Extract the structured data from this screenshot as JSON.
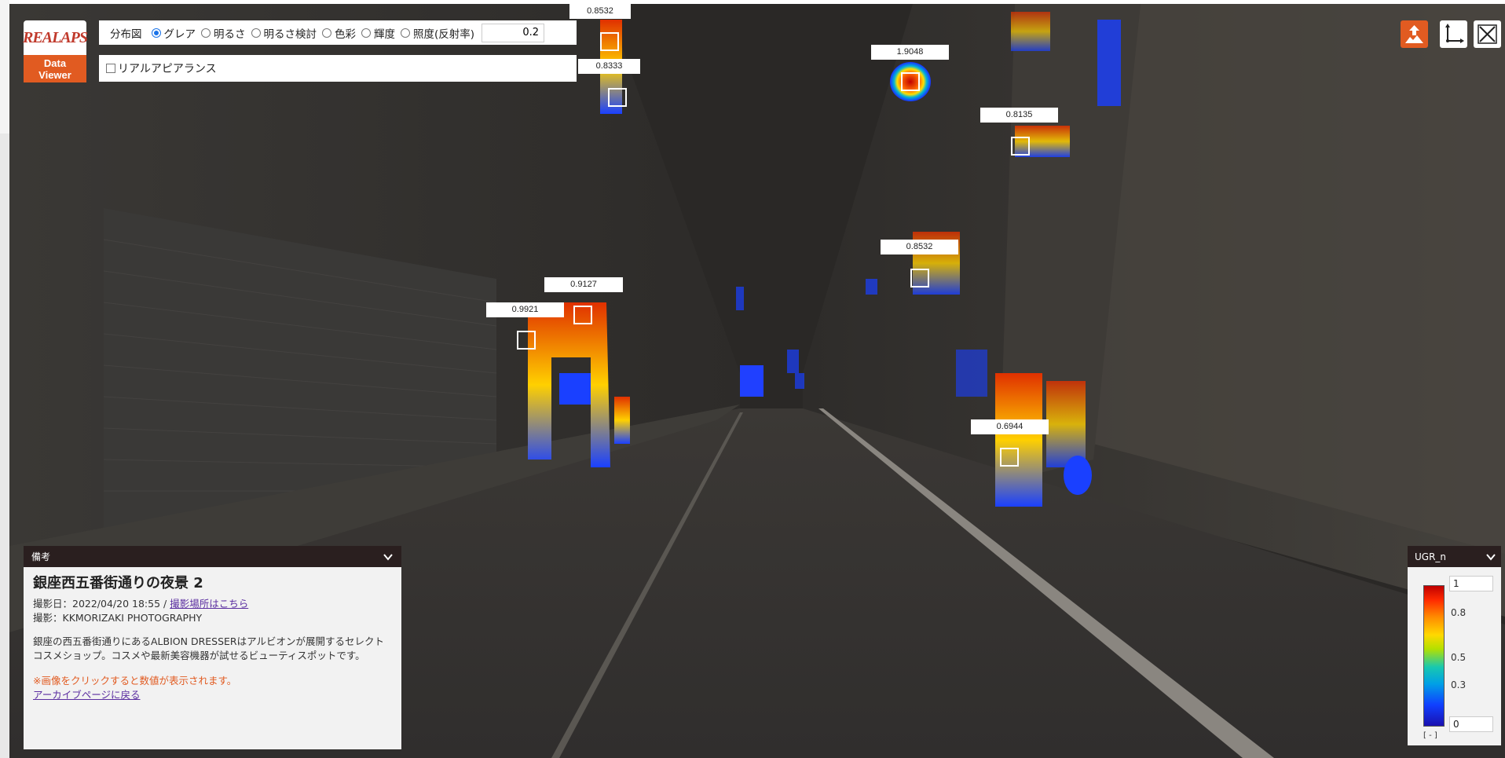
{
  "logo": {
    "brand": "REALAPS",
    "line1": "Data",
    "line2": "Viewer"
  },
  "controls": {
    "label": "分布図",
    "options": [
      {
        "label": "グレア",
        "selected": true
      },
      {
        "label": "明るさ",
        "selected": false
      },
      {
        "label": "明るさ検討",
        "selected": false
      },
      {
        "label": "色彩",
        "selected": false
      },
      {
        "label": "輝度",
        "selected": false
      },
      {
        "label": "照度(反射率)",
        "selected": false
      }
    ],
    "threshold": "0.2",
    "real_appearance_label": "リアルアピアランス",
    "real_appearance_checked": false
  },
  "toolbar": {
    "icons": [
      "upload-image-icon",
      "axis-icon",
      "close-cross-icon"
    ],
    "accent": "#e15b21"
  },
  "glare_points": [
    {
      "value": "0.8532"
    },
    {
      "value": "0.8333"
    },
    {
      "value": "1.9048"
    },
    {
      "value": "0.8135"
    },
    {
      "value": "0.8532"
    },
    {
      "value": "0.9127"
    },
    {
      "value": "0.9921"
    },
    {
      "value": "0.6944"
    }
  ],
  "note": {
    "header": "備考",
    "title": "銀座西五番街通りの夜景 2",
    "date_prefix": "撮影日：2022/04/20 18:55 / ",
    "location_link": "撮影場所はこちら",
    "photographer": "撮影：KKMORIZAKI PHOTOGRAPHY",
    "description": "銀座の西五番街通りにあるALBION DRESSERはアルビオンが展開するセレクトコスメショップ。コスメや最新美容機器が試せるビューティスポットです。",
    "warning": "※画像をクリックすると数値が表示されます。",
    "archive_link": "アーカイブページに戻る"
  },
  "legend": {
    "title": "UGR_n",
    "max": "1",
    "min": "0",
    "ticks": [
      "0.8",
      "0.5",
      "0.3"
    ],
    "unit": "[ - ]"
  }
}
